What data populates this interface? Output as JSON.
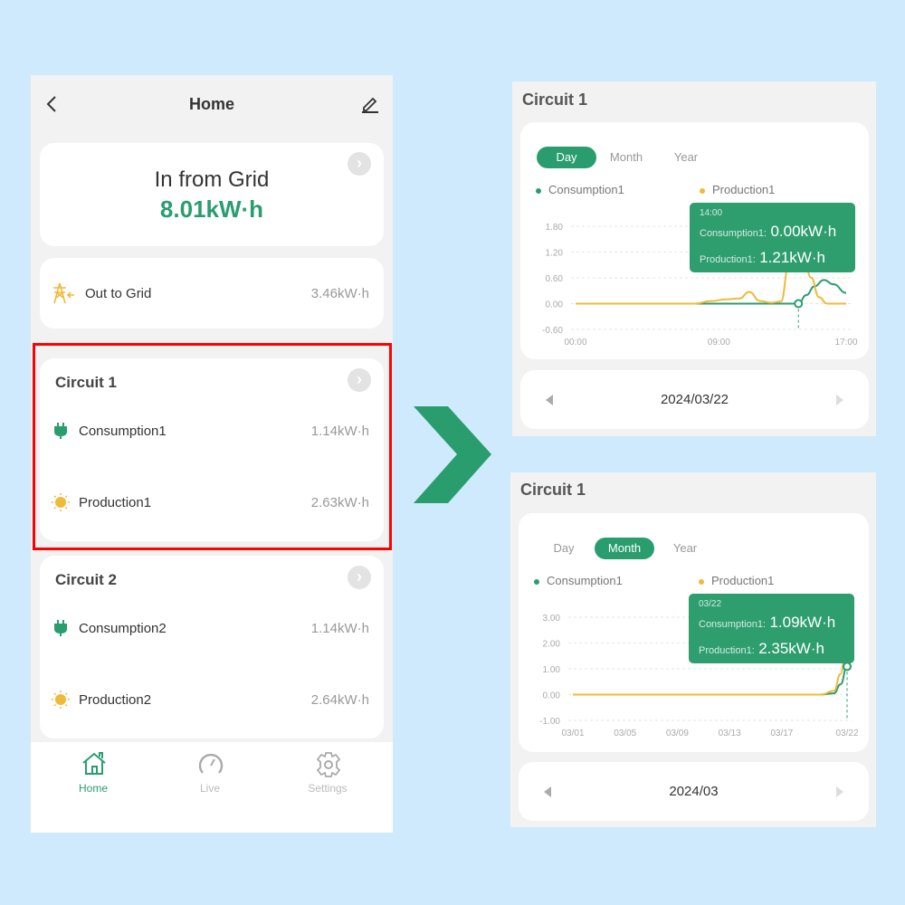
{
  "colors": {
    "accent": "#2a9d6f",
    "production": "#f0b93a",
    "highlight_box": "#ff0000",
    "background": "#cfeafc"
  },
  "phone": {
    "header": {
      "title": "Home",
      "back_icon": "chevron-left-icon",
      "edit_icon": "pencil-icon"
    },
    "in_from_grid": {
      "label": "In from Grid",
      "value": "8.01kW·h"
    },
    "out_to_grid": {
      "label": "Out to Grid",
      "value": "3.46kW·h",
      "icon": "power-tower-icon"
    },
    "circuits": [
      {
        "title": "Circuit 1",
        "rows": [
          {
            "label": "Consumption1",
            "value": "1.14kW·h",
            "icon": "plug-icon"
          },
          {
            "label": "Production1",
            "value": "2.63kW·h",
            "icon": "sun-icon"
          }
        ]
      },
      {
        "title": "Circuit 2",
        "rows": [
          {
            "label": "Consumption2",
            "value": "1.14kW·h",
            "icon": "plug-icon"
          },
          {
            "label": "Production2",
            "value": "2.64kW·h",
            "icon": "sun-icon"
          }
        ]
      }
    ],
    "nav": [
      {
        "label": "Home",
        "icon": "home-icon",
        "active": true
      },
      {
        "label": "Live",
        "icon": "gauge-icon"
      },
      {
        "label": "Settings",
        "icon": "gear-icon"
      }
    ]
  },
  "panels": [
    {
      "title": "Circuit 1",
      "tabs": [
        "Day",
        "Month",
        "Year"
      ],
      "active_tab": "Day",
      "date": "2024/03/22",
      "tooltip": {
        "time": "14:00",
        "consumption_label": "Consumption1:",
        "consumption_value": "0.00kW·h",
        "production_label": "Production1:",
        "production_value": "1.21kW·h"
      }
    },
    {
      "title": "Circuit 1",
      "tabs": [
        "Day",
        "Month",
        "Year"
      ],
      "active_tab": "Month",
      "date": "2024/03",
      "tooltip": {
        "time": "03/22",
        "consumption_label": "Consumption1:",
        "consumption_value": "1.09kW·h",
        "production_label": "Production1:",
        "production_value": "2.35kW·h"
      }
    }
  ],
  "chart_data": [
    {
      "type": "line",
      "legend": [
        "Consumption1",
        "Production1"
      ],
      "legend_placement": "top",
      "grid": true,
      "yticks": [
        "1.80",
        "1.20",
        "0.60",
        "0.00",
        "-0.60"
      ],
      "ylim": [
        -0.6,
        1.8
      ],
      "xticks": [
        "00:00",
        "09:00",
        "17:00"
      ],
      "xlim": [
        0,
        17
      ],
      "x_unit": "hour",
      "series": [
        {
          "name": "Consumption1",
          "x": [
            0,
            8,
            13,
            14,
            14.5,
            15,
            15.6,
            16.2,
            17
          ],
          "values": [
            0,
            0,
            0,
            0,
            0.2,
            0.4,
            0.55,
            0.45,
            0.25
          ]
        },
        {
          "name": "Production1",
          "x": [
            0,
            7.5,
            8.5,
            9.5,
            10.3,
            10.9,
            11.6,
            12.3,
            12.9,
            13.4,
            13.8,
            14.2,
            14.8,
            15.3,
            15.8,
            17
          ],
          "values": [
            0,
            0,
            0.06,
            0.1,
            0.12,
            0.27,
            0.06,
            0.02,
            0.05,
            0.9,
            1.8,
            1.4,
            0.6,
            0.15,
            0,
            0
          ]
        }
      ]
    },
    {
      "type": "line",
      "legend": [
        "Consumption1",
        "Production1"
      ],
      "legend_placement": "top",
      "grid": true,
      "yticks": [
        "3.00",
        "2.00",
        "1.00",
        "0.00",
        "-1.00"
      ],
      "ylim": [
        -1,
        3
      ],
      "xticks": [
        "03/01",
        "03/05",
        "03/09",
        "03/13",
        "03/17",
        "03/22"
      ],
      "xlim": [
        1,
        22
      ],
      "x_unit": "day",
      "series": [
        {
          "name": "Consumption1",
          "x": [
            1,
            20,
            21,
            21.5,
            22
          ],
          "values": [
            0,
            0,
            0.05,
            0.4,
            1.09
          ]
        },
        {
          "name": "Production1",
          "x": [
            1,
            20,
            21,
            21.5,
            22
          ],
          "values": [
            0,
            0,
            0.15,
            0.8,
            2.35
          ]
        }
      ]
    }
  ]
}
